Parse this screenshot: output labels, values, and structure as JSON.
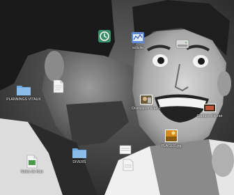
{
  "desktop": {
    "wallpaper": "black-and-white-photo-two-men-kiss-on-cheek",
    "icons": [
      {
        "label": "",
        "icon": "time-machine-icon"
      },
      {
        "label": "activite",
        "icon": "activity-monitor-icon"
      },
      {
        "label": "",
        "icon": "hard-drive-icon"
      },
      {
        "label": "PLANNINGS VITAUX",
        "icon": "folder-icon"
      },
      {
        "label": "",
        "icon": "document-icon"
      },
      {
        "label": "Discussion iPad 2",
        "icon": "image-file-icon"
      },
      {
        "label": "Capture d'écran",
        "icon": "image-file-icon"
      },
      {
        "label": "PLAGES.jpg",
        "icon": "image-file-icon"
      },
      {
        "label": "DIVERS",
        "icon": "folder-icon"
      },
      {
        "label": "",
        "icon": "text-file-icon"
      },
      {
        "label": "Notes de frais",
        "icon": "document-icon"
      },
      {
        "label": "",
        "icon": "document-icon"
      }
    ]
  }
}
